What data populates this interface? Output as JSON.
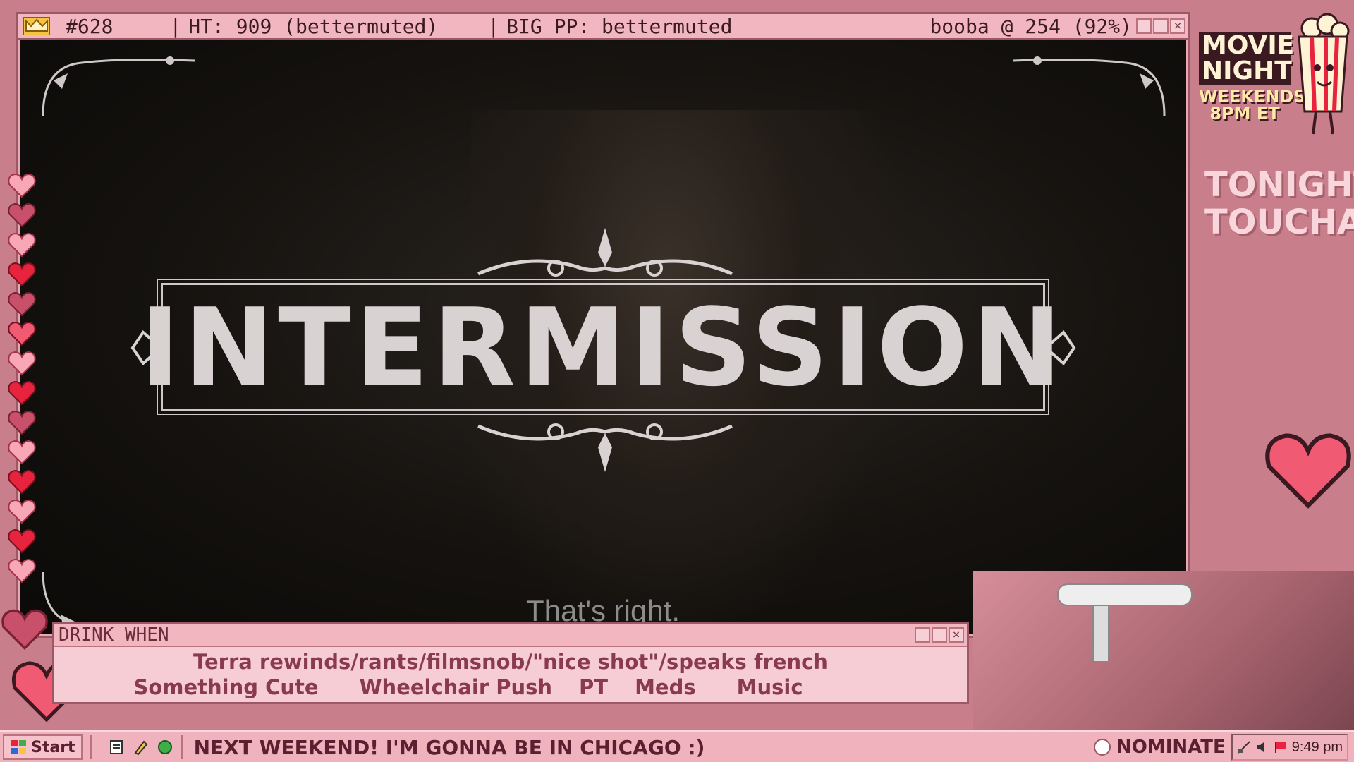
{
  "main_window": {
    "titlebar": {
      "id": "#628",
      "ht": "HT: 909 (bettermuted)",
      "big_pp": "BIG PP: bettermuted",
      "right": "booba @ 254 (92%)"
    },
    "intermission_text": "INTERMISSION",
    "subtitle": "That's right."
  },
  "drink_window": {
    "title": "DRINK WHEN",
    "line1": "Terra rewinds/rants/filmsnob/\"nice shot\"/speaks french",
    "items": [
      "Something Cute",
      "Wheelchair Push",
      "PT",
      "Meds",
      "Music"
    ]
  },
  "taskbar": {
    "start_label": "Start",
    "ticker": "NEXT WEEKEND!  I'M GONNA BE IN CHICAGO :)",
    "nominate_label": "NOMINATE",
    "clock": "9:49 pm"
  },
  "overlay": {
    "movie_night_line1": "MOVIE",
    "movie_night_line2": "NIGHT",
    "movie_night_sub1": "WEEKENDS",
    "movie_night_sub2": "8PM ET",
    "tonight_label": "TONIGHT:",
    "tonight_title": "TOUCHABL"
  },
  "colors": {
    "background": "#c97e8b",
    "window_pink": "#f2b6c0",
    "heart_red": "#e8233d",
    "heart_pink": "#f7a7b6"
  }
}
